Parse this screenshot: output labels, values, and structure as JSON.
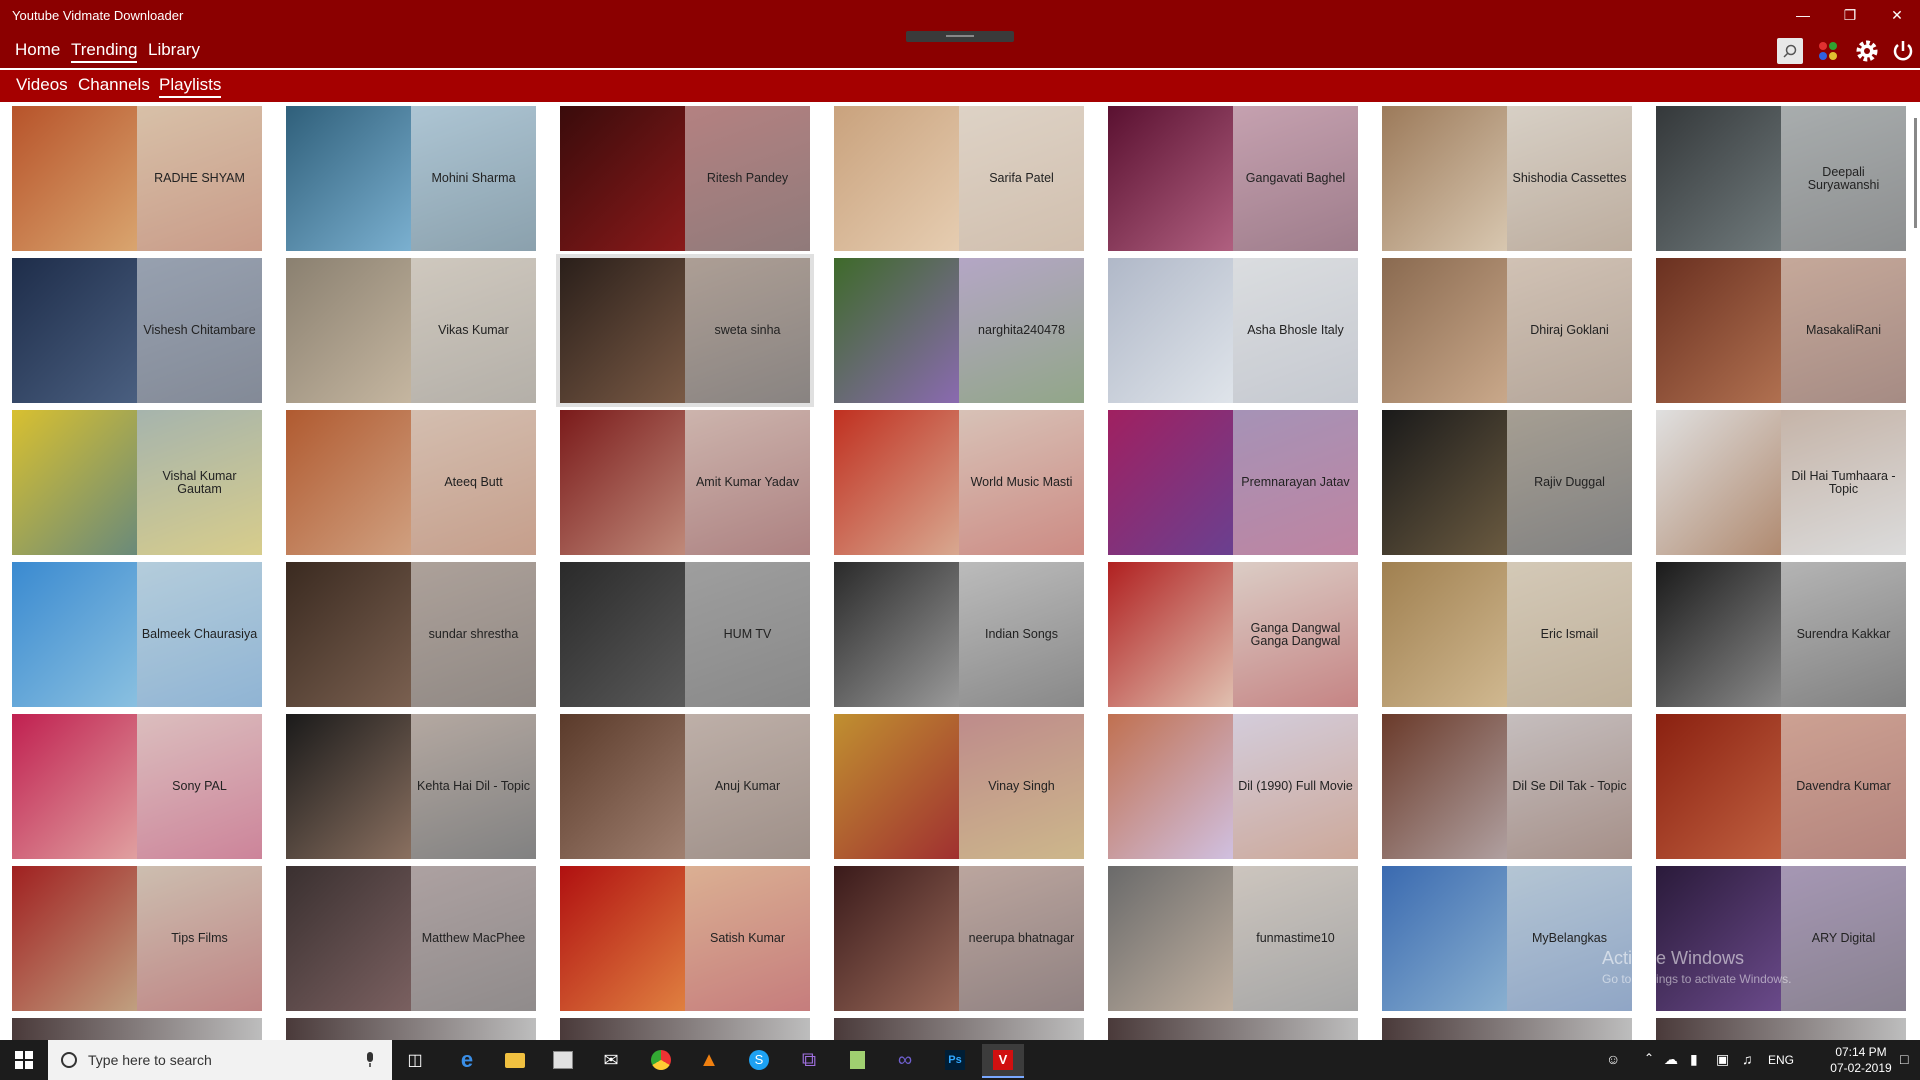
{
  "window": {
    "title": "Youtube Vidmate Downloader"
  },
  "nav": {
    "home": "Home",
    "trending": "Trending",
    "library": "Library"
  },
  "subnav": {
    "videos": "Videos",
    "channels": "Channels",
    "playlists": "Playlists"
  },
  "colors": {
    "titlebar": "#8b0000",
    "subnav": "#a50000"
  },
  "tiles": [
    {
      "label": "RADHE SHYAM",
      "c1": "#b7532a",
      "c2": "#d9a56f"
    },
    {
      "label": "Mohini Sharma",
      "c1": "#2f5f7a",
      "c2": "#7bb0d0"
    },
    {
      "label": "Ritesh Pandey",
      "c1": "#3a0b0b",
      "c2": "#8a1a1a"
    },
    {
      "label": "Sarifa Patel",
      "c1": "#c9a27d",
      "c2": "#e6cdb1"
    },
    {
      "label": "Gangavati Baghel",
      "c1": "#5a1030",
      "c2": "#b06080"
    },
    {
      "label": "Shishodia Cassettes",
      "c1": "#9c7a5a",
      "c2": "#d8c7b0"
    },
    {
      "label": "Deepali Suryawanshi",
      "c1": "#34383a",
      "c2": "#707a7c"
    },
    {
      "label": "Vishesh Chitambare",
      "c1": "#1e2d4a",
      "c2": "#4a5f80"
    },
    {
      "label": "Vikas Kumar",
      "c1": "#8a8070",
      "c2": "#c5b6a0"
    },
    {
      "label": "sweta sinha",
      "c1": "#2a1f1a",
      "c2": "#7a5a45"
    },
    {
      "label": "narghita240478",
      "c1": "#3e6a2a",
      "c2": "#8a6ab0"
    },
    {
      "label": "Asha Bhosle Italy",
      "c1": "#b0b8c8",
      "c2": "#dfe4ea"
    },
    {
      "label": "Dhiraj Goklani",
      "c1": "#8a6a50",
      "c2": "#c9a88a"
    },
    {
      "label": "MasakaliRani",
      "c1": "#6a3020",
      "c2": "#b07050"
    },
    {
      "label": "Vishal Kumar Gautam",
      "c1": "#d8c030",
      "c2": "#6a8a7a"
    },
    {
      "label": "Ateeq Butt",
      "c1": "#b05a30",
      "c2": "#d0a080"
    },
    {
      "label": "Amit Kumar Yadav",
      "c1": "#7a1a1a",
      "c2": "#c08a7a"
    },
    {
      "label": "World Music Masti",
      "c1": "#c03020",
      "c2": "#d8a890"
    },
    {
      "label": "Premnarayan Jatav",
      "c1": "#a02060",
      "c2": "#6a4090"
    },
    {
      "label": "Rajiv Duggal",
      "c1": "#1a1a1a",
      "c2": "#6a5a40"
    },
    {
      "label": "Dil Hai Tumhaara - Topic",
      "c1": "#e0e0e0",
      "c2": "#b08a70"
    },
    {
      "label": "Balmeek Chaurasiya",
      "c1": "#3a8ad0",
      "c2": "#8ac0e0"
    },
    {
      "label": "sundar shrestha",
      "c1": "#3a2a20",
      "c2": "#7a6050"
    },
    {
      "label": "HUM TV",
      "c1": "#2a2a2a",
      "c2": "#5a5a5a"
    },
    {
      "label": "Indian Songs",
      "c1": "#2a2a2a",
      "c2": "#9a9a9a"
    },
    {
      "label": "Ganga Dangwal Ganga Dangwal",
      "c1": "#b02020",
      "c2": "#e0c0b0"
    },
    {
      "label": "Eric Ismail",
      "c1": "#a08050",
      "c2": "#d0b890"
    },
    {
      "label": "Surendra Kakkar",
      "c1": "#1a1a1a",
      "c2": "#8a8a8a"
    },
    {
      "label": "Sony PAL",
      "c1": "#c02050",
      "c2": "#e0a0a0"
    },
    {
      "label": "Kehta Hai Dil - Topic",
      "c1": "#1a1a1a",
      "c2": "#8a7060"
    },
    {
      "label": "Anuj Kumar",
      "c1": "#5a3a2a",
      "c2": "#a08070"
    },
    {
      "label": "Vinay Singh",
      "c1": "#c09030",
      "c2": "#a03030"
    },
    {
      "label": "Dil (1990) Full Movie",
      "c1": "#c07050",
      "c2": "#d0c0e0"
    },
    {
      "label": "Dil Se Dil Tak - Topic",
      "c1": "#6a3a2a",
      "c2": "#b0a0a0"
    },
    {
      "label": "Davendra Kumar",
      "c1": "#8a2010",
      "c2": "#c06040"
    },
    {
      "label": "Tips Films",
      "c1": "#a02020",
      "c2": "#c0a080"
    },
    {
      "label": "Matthew MacPhee",
      "c1": "#3a3030",
      "c2": "#7a6060"
    },
    {
      "label": "Satish Kumar",
      "c1": "#b01010",
      "c2": "#e08040"
    },
    {
      "label": "neerupa bhatnagar",
      "c1": "#3a1a1a",
      "c2": "#9a6a5a"
    },
    {
      "label": "funmastime10",
      "c1": "#6a6a6a",
      "c2": "#c0b0a0"
    },
    {
      "label": "MyBelangkas",
      "c1": "#3a6ab0",
      "c2": "#8ab0d0"
    },
    {
      "label": "ARY Digital",
      "c1": "#2a1a3a",
      "c2": "#6a4a8a"
    }
  ],
  "system": {
    "activate1": "Activate Windows",
    "activate2": "Go to Settings to activate Windows.",
    "taskbar_search": "Type here to search",
    "time": "07:14 PM",
    "date": "07-02-2019",
    "lang": "ENG"
  }
}
